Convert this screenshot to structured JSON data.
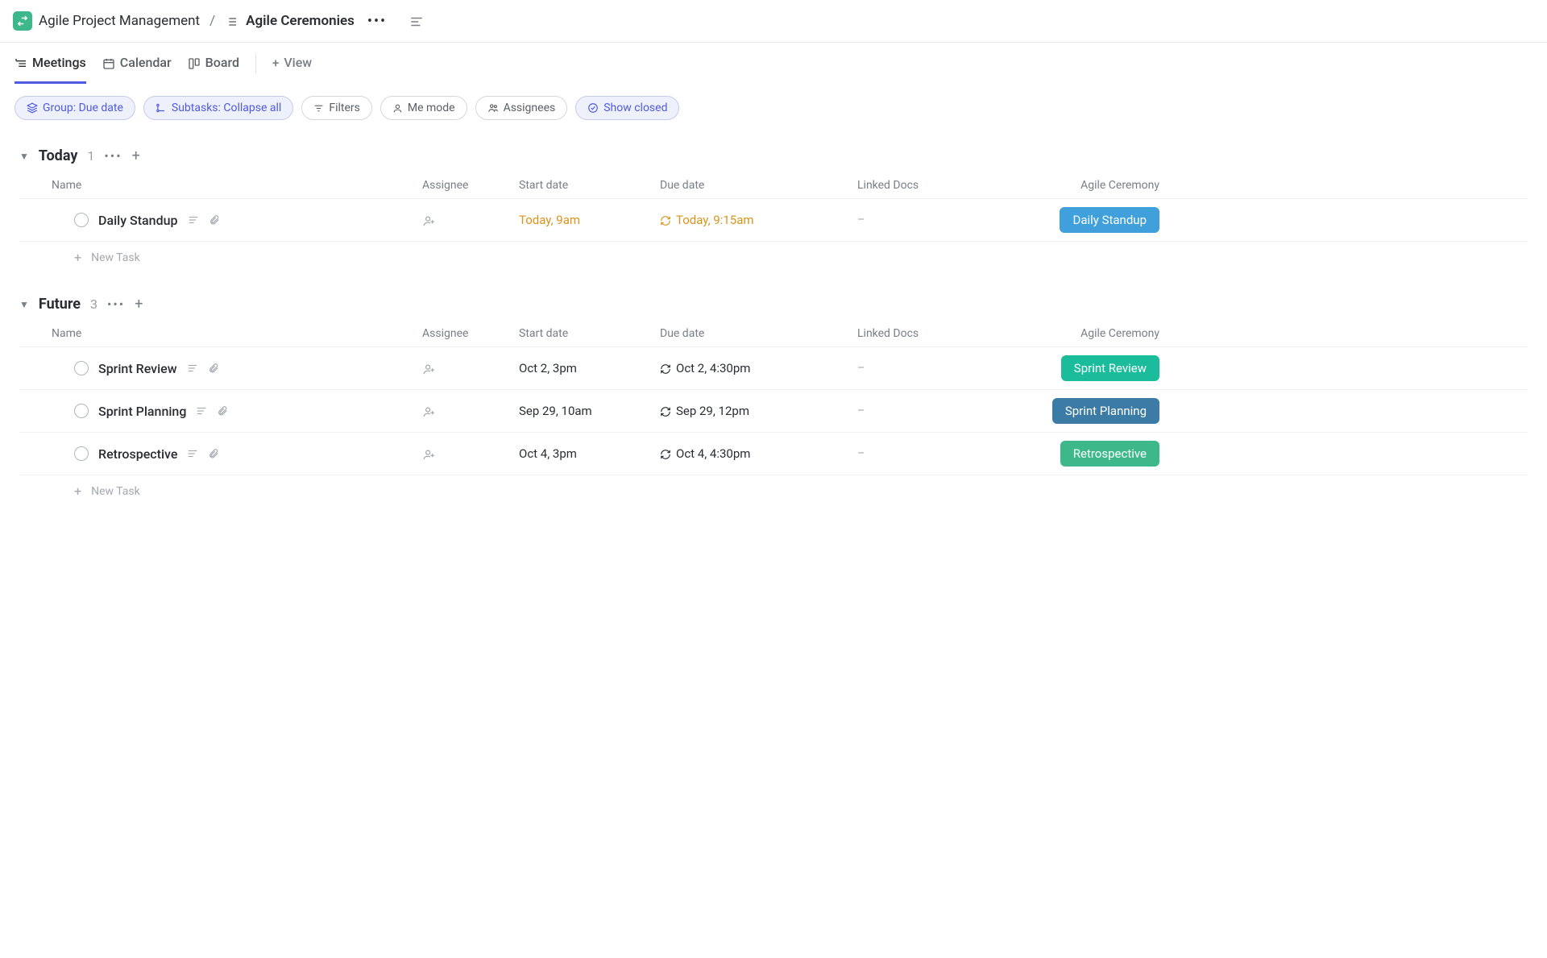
{
  "header": {
    "parent": "Agile Project Management",
    "separator": "/",
    "current": "Agile Ceremonies"
  },
  "tabs": {
    "meetings": "Meetings",
    "calendar": "Calendar",
    "board": "Board",
    "add_view": "View"
  },
  "toolbar": {
    "group": "Group: Due date",
    "subtasks": "Subtasks: Collapse all",
    "filters": "Filters",
    "me_mode": "Me mode",
    "assignees": "Assignees",
    "show_closed": "Show closed"
  },
  "columns": {
    "name": "Name",
    "assignee": "Assignee",
    "start_date": "Start date",
    "due_date": "Due date",
    "linked_docs": "Linked Docs",
    "ceremony": "Agile Ceremony"
  },
  "new_task": "New Task",
  "groups": [
    {
      "title": "Today",
      "count": "1",
      "today": true,
      "tasks": [
        {
          "name": "Daily Standup",
          "start": "Today, 9am",
          "due": "Today, 9:15am",
          "docs": "–",
          "ceremony": "Daily Standup",
          "badge_class": "lightblue"
        }
      ]
    },
    {
      "title": "Future",
      "count": "3",
      "today": false,
      "tasks": [
        {
          "name": "Sprint Review",
          "start": "Oct 2, 3pm",
          "due": "Oct 2, 4:30pm",
          "docs": "–",
          "ceremony": "Sprint Review",
          "badge_class": "teal"
        },
        {
          "name": "Sprint Planning",
          "start": "Sep 29, 10am",
          "due": "Sep 29, 12pm",
          "docs": "–",
          "ceremony": "Sprint Planning",
          "badge_class": "steelblue"
        },
        {
          "name": "Retrospective",
          "start": "Oct 4, 3pm",
          "due": "Oct 4, 4:30pm",
          "docs": "–",
          "ceremony": "Retrospective",
          "badge_class": "green"
        }
      ]
    }
  ]
}
